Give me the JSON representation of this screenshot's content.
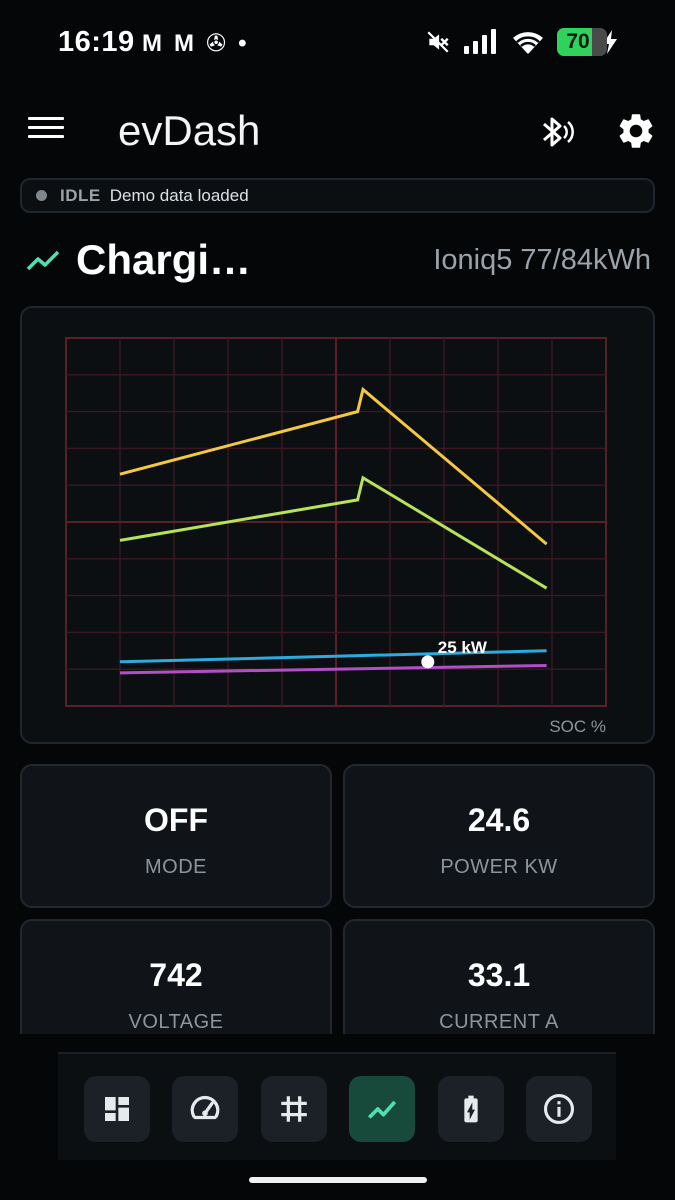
{
  "status_bar": {
    "time": "16:19",
    "notifications": [
      "M",
      "M",
      "✇",
      "•"
    ],
    "battery_percent": "70",
    "icons": [
      "mute-icon",
      "signal-icon",
      "wifi-icon",
      "battery-icon",
      "charging-bolt-icon"
    ]
  },
  "app_bar": {
    "title": "evDash",
    "icons": [
      "menu-icon",
      "bluetooth-icon",
      "gear-icon"
    ]
  },
  "connection": {
    "state": "IDLE",
    "message": "Demo data loaded"
  },
  "section": {
    "title": "Chargi…",
    "car": "Ioniq5 77/84kWh"
  },
  "chart_data": {
    "type": "line",
    "xlabel": "SOC %",
    "grid": true,
    "xlim": [
      0,
      10
    ],
    "ylim": [
      0,
      10
    ],
    "series": [
      {
        "color": "#f5c842",
        "x": [
          1.0,
          5.4,
          5.5,
          8.9
        ],
        "y": [
          6.3,
          8.0,
          8.6,
          4.4
        ]
      },
      {
        "color": "#b6e35a",
        "x": [
          1.0,
          5.4,
          5.5,
          8.9
        ],
        "y": [
          4.5,
          5.6,
          6.2,
          3.2
        ]
      },
      {
        "color": "#2eaadf",
        "x": [
          1.0,
          8.9
        ],
        "y": [
          1.2,
          1.5
        ]
      },
      {
        "color": "#b14fc9",
        "x": [
          1.0,
          8.9
        ],
        "y": [
          0.9,
          1.1
        ]
      }
    ],
    "marker": {
      "x": 6.7,
      "y": 1.2,
      "label": "25 kW"
    }
  },
  "stats": [
    {
      "value": "OFF",
      "label": "MODE"
    },
    {
      "value": "24.6",
      "label": "POWER KW"
    },
    {
      "value": "742",
      "label": "VOLTAGE"
    },
    {
      "value": "33.1",
      "label": "CURRENT A"
    }
  ],
  "bottom_nav": {
    "items": [
      "dashboard-icon",
      "speedometer-icon",
      "grid-icon",
      "chart-icon",
      "battery-icon",
      "info-icon"
    ],
    "active_index": 3,
    "active_color": "#4fe0b0"
  }
}
